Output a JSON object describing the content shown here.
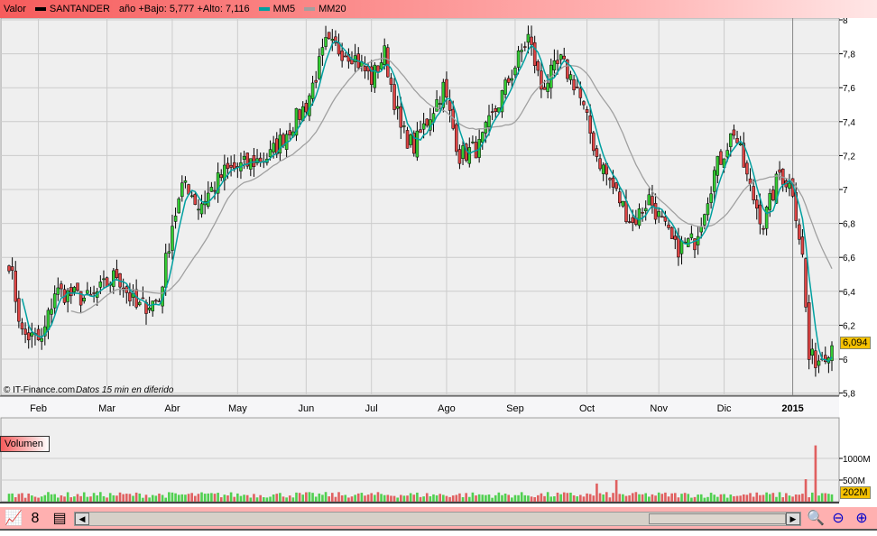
{
  "legend": {
    "valor": "Valor",
    "ticker": "SANTANDER",
    "range": "año +Bajo: 5,777 +Alto: 7,116",
    "mm5": "MM5",
    "mm20": "MM20",
    "ticker_color": "#000000",
    "mm5_color": "#00a0a0",
    "mm20_color": "#a0a0a0"
  },
  "credit": "© IT-Finance.com",
  "delay": "Datos 15 min en diferido",
  "volume_label": "Volumen",
  "last_price": "6,094",
  "last_volume": "202M",
  "toolbar": {
    "left": "scroll-left",
    "right": "scroll-right"
  },
  "chart_data": {
    "type": "candlestick",
    "title": "SANTANDER",
    "ylim": [
      5.7,
      8.0
    ],
    "y_ticks": [
      {
        "v": 5.8,
        "l": "5,8"
      },
      {
        "v": 6.0,
        "l": "6"
      },
      {
        "v": 6.2,
        "l": "6,2"
      },
      {
        "v": 6.4,
        "l": "6,4"
      },
      {
        "v": 6.6,
        "l": "6,6"
      },
      {
        "v": 6.8,
        "l": "6,8"
      },
      {
        "v": 7.0,
        "l": "7"
      },
      {
        "v": 7.2,
        "l": "7,2"
      },
      {
        "v": 7.4,
        "l": "7,4"
      },
      {
        "v": 7.6,
        "l": "7,6"
      },
      {
        "v": 7.8,
        "l": "7,8"
      },
      {
        "v": 8.0,
        "l": "8"
      }
    ],
    "x_ticks": [
      {
        "d": 9,
        "l": "Feb"
      },
      {
        "d": 30,
        "l": "Mar"
      },
      {
        "d": 50,
        "l": "Abr"
      },
      {
        "d": 70,
        "l": "May"
      },
      {
        "d": 91,
        "l": "Jun"
      },
      {
        "d": 111,
        "l": "Jul"
      },
      {
        "d": 134,
        "l": "Ago"
      },
      {
        "d": 155,
        "l": "Sep"
      },
      {
        "d": 177,
        "l": "Oct"
      },
      {
        "d": 199,
        "l": "Nov"
      },
      {
        "d": 219,
        "l": "Dic"
      },
      {
        "d": 240,
        "l": "2015",
        "bold": true
      }
    ],
    "days": 252,
    "close_keypoints": [
      [
        0,
        6.58
      ],
      [
        4,
        6.15
      ],
      [
        10,
        6.1
      ],
      [
        14,
        6.4
      ],
      [
        25,
        6.35
      ],
      [
        33,
        6.5
      ],
      [
        39,
        6.3
      ],
      [
        46,
        6.35
      ],
      [
        50,
        6.8
      ],
      [
        54,
        7.05
      ],
      [
        58,
        6.9
      ],
      [
        66,
        7.1
      ],
      [
        80,
        7.2
      ],
      [
        91,
        7.5
      ],
      [
        97,
        7.85
      ],
      [
        105,
        7.8
      ],
      [
        111,
        7.65
      ],
      [
        115,
        7.8
      ],
      [
        120,
        7.35
      ],
      [
        124,
        7.25
      ],
      [
        133,
        7.6
      ],
      [
        138,
        7.2
      ],
      [
        144,
        7.25
      ],
      [
        152,
        7.6
      ],
      [
        159,
        7.9
      ],
      [
        163,
        7.6
      ],
      [
        169,
        7.75
      ],
      [
        174,
        7.6
      ],
      [
        180,
        7.2
      ],
      [
        188,
        6.9
      ],
      [
        191,
        6.8
      ],
      [
        196,
        6.95
      ],
      [
        204,
        6.65
      ],
      [
        210,
        6.7
      ],
      [
        216,
        7.1
      ],
      [
        222,
        7.35
      ],
      [
        227,
        7.0
      ],
      [
        231,
        6.8
      ],
      [
        236,
        7.1
      ],
      [
        240,
        7.0
      ],
      [
        243,
        6.6
      ],
      [
        245,
        6.0
      ],
      [
        248,
        6.0
      ],
      [
        252,
        6.09
      ]
    ],
    "volume": {
      "ylim": [
        0,
        1400
      ],
      "ticks": [
        {
          "v": 500,
          "l": "500M"
        },
        {
          "v": 1000,
          "l": "1000M"
        }
      ],
      "typical": 150,
      "spikes": [
        [
          180,
          420
        ],
        [
          186,
          500
        ],
        [
          244,
          520
        ],
        [
          247,
          1300
        ]
      ]
    }
  }
}
